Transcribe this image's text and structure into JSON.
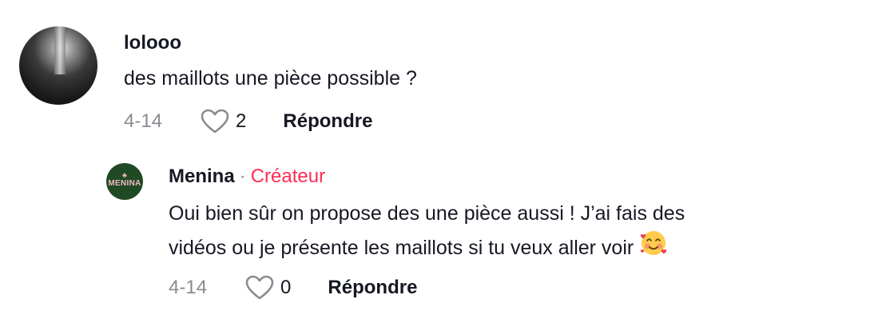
{
  "comments": [
    {
      "username": "lolooo",
      "text": "des maillots une pièce possible ?",
      "date": "4-14",
      "likes": "2",
      "reply_label": "Répondre",
      "avatar_icon": "profile-photo"
    }
  ],
  "reply": {
    "username": "Menina",
    "separator": "·",
    "badge": "Créateur",
    "text_line1": "Oui bien sûr on propose des une pièce aussi ! J’ai fais des",
    "text_line2": "vidéos ou je présente les maillots si tu veux aller voir",
    "emoji": "smiling-face-with-hearts",
    "date": "4-14",
    "likes": "0",
    "reply_label": "Répondre",
    "avatar_brand": "MENINA",
    "avatar_icon": "brand-logo"
  },
  "colors": {
    "creator_badge": "#fe2c55",
    "meta_gray": "#8a8b91",
    "text": "#161823",
    "avatar_brand_bg": "#1f4a24"
  }
}
